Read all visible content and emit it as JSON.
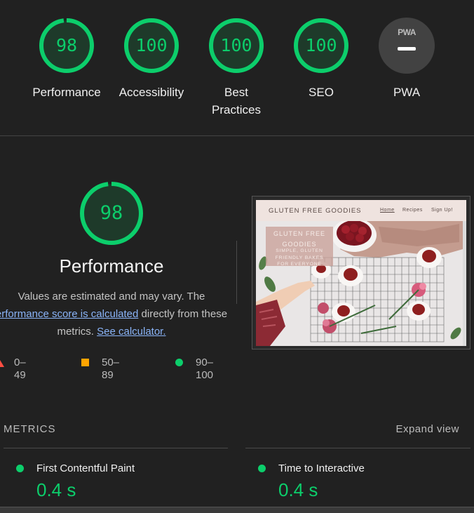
{
  "scores": [
    {
      "label": "Performance",
      "value": "98",
      "fraction": 0.98
    },
    {
      "label": "Accessibility",
      "value": "100",
      "fraction": 1.0
    },
    {
      "label": "Best Practices",
      "value": "100",
      "fraction": 1.0
    },
    {
      "label": "SEO",
      "value": "100",
      "fraction": 1.0
    }
  ],
  "pwa": {
    "badge_text": "PWA",
    "label": "PWA"
  },
  "performance": {
    "score": "98",
    "fraction": 0.98,
    "title": "Performance",
    "desc_part1": "Values are estimated and may vary. The",
    "desc_link1": "erformance score is calculated",
    "desc_part2": " directly from these",
    "desc_part3": "metrics. ",
    "desc_link2": "See calculator."
  },
  "legend": {
    "fail": "0–49",
    "average": "50–89",
    "pass": "90–100"
  },
  "screenshot": {
    "logo": "GLUTEN FREE GOODIES",
    "nav_home": "Home",
    "nav_recipes": "Recipes",
    "nav_signup": "Sign Up!",
    "overlay_title_1": "GLUTEN FREE",
    "overlay_title_2": "GOODIES",
    "overlay_sub_1": "SIMPLE, GLUTEN",
    "overlay_sub_2": "FRIENDLY BAKES",
    "overlay_sub_3": "FOR EVERYONE"
  },
  "metrics": {
    "header": "METRICS",
    "expand_label": "Expand view",
    "items": [
      {
        "title": "First Contentful Paint",
        "value": "0.4 s"
      },
      {
        "title": "Time to Interactive",
        "value": "0.4 s"
      }
    ]
  },
  "colors": {
    "pass": "#0cce6b",
    "average": "#ffa400",
    "fail": "#ff4e42",
    "background": "#212121"
  }
}
